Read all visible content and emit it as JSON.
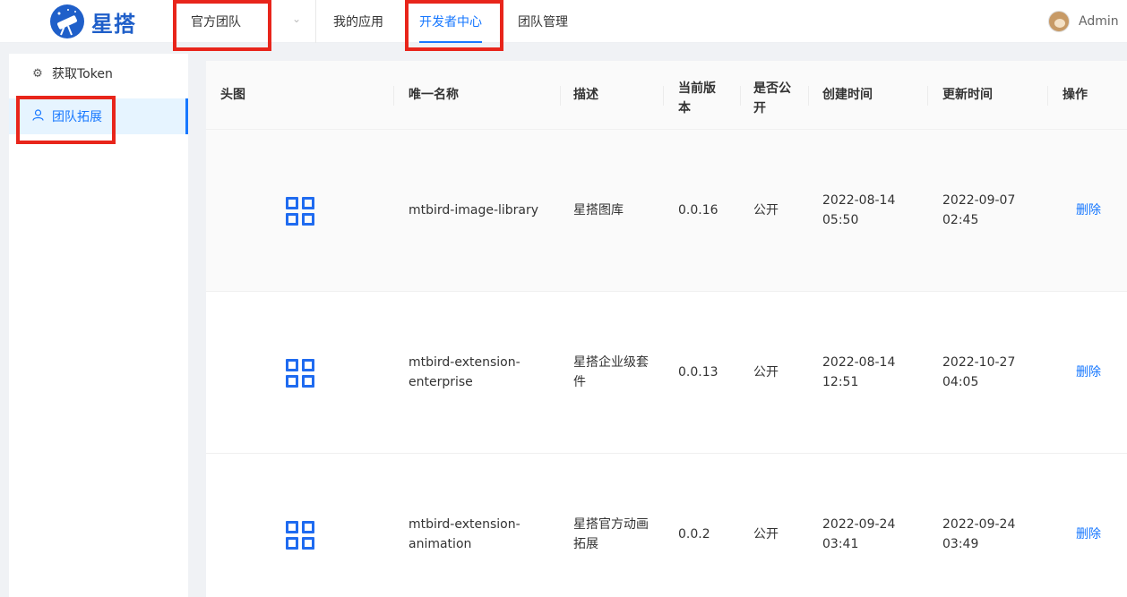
{
  "header": {
    "logo_text": "星搭",
    "team_select": "官方团队",
    "nav": [
      "我的应用",
      "开发者中心",
      "团队管理"
    ],
    "active_nav": "开发者中心",
    "user": "Admin"
  },
  "sidebar": {
    "items": [
      {
        "label": "获取Token",
        "icon": "gear-icon"
      },
      {
        "label": "团队拓展",
        "icon": "user-icon",
        "active": true
      }
    ]
  },
  "table": {
    "headers": [
      "头图",
      "唯一名称",
      "描述",
      "当前版\n本",
      "是否公\n开",
      "创建时间",
      "更新时间",
      "操作"
    ],
    "rows": [
      {
        "name": "mtbird-image-library",
        "desc": "星搭图库",
        "version": "0.0.16",
        "public": "公开",
        "created": "2022-08-14\n05:50",
        "updated": "2022-09-07\n02:45",
        "action": "删除"
      },
      {
        "name": "mtbird-extension-\nenterprise",
        "desc": "星搭企业级套\n件",
        "version": "0.0.13",
        "public": "公开",
        "created": "2022-08-14\n12:51",
        "updated": "2022-10-27\n04:05",
        "action": "删除"
      },
      {
        "name": "mtbird-extension-\nanimation",
        "desc": "星搭官方动画\n拓展",
        "version": "0.0.2",
        "public": "公开",
        "created": "2022-09-24\n03:41",
        "updated": "2022-09-24\n03:49",
        "action": "删除"
      }
    ]
  },
  "colors": {
    "accent": "#1677ff",
    "highlight": "#e8251b",
    "logo": "#1f5fc9"
  }
}
